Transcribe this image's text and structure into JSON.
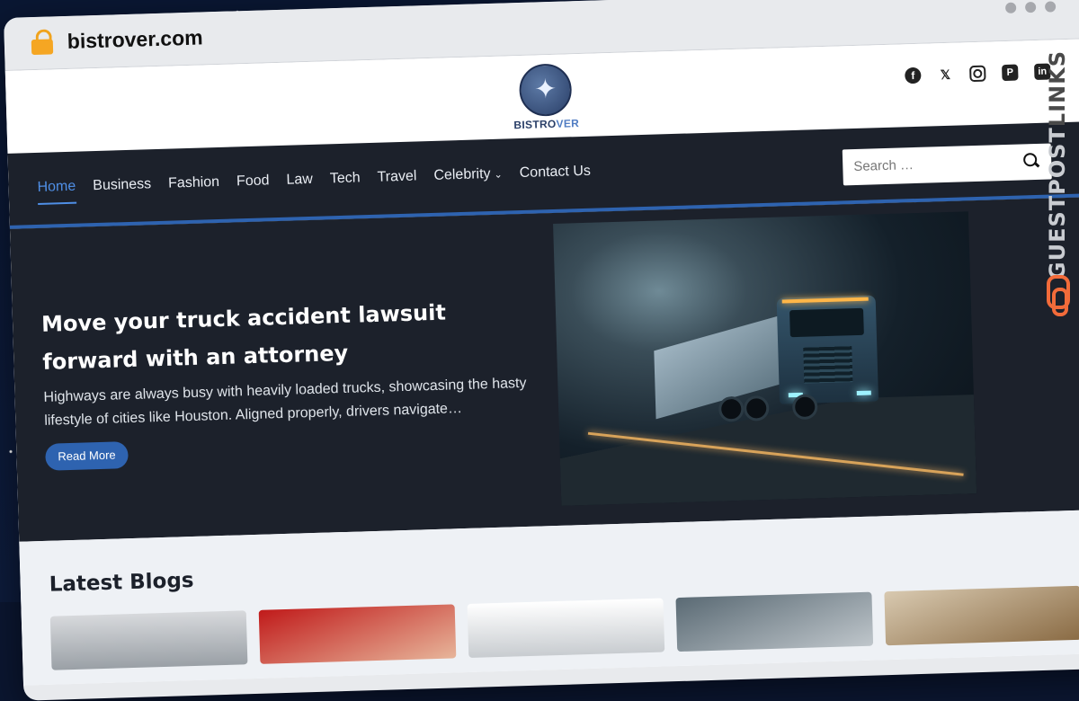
{
  "browser": {
    "url": "bistrover.com"
  },
  "site": {
    "logo_text_a": "BISTRO",
    "logo_text_b": "VER",
    "socials": [
      "facebook-icon",
      "x-icon",
      "instagram-icon",
      "pinterest-icon",
      "linkedin-icon"
    ]
  },
  "nav": {
    "items": [
      {
        "label": "Home",
        "active": true
      },
      {
        "label": "Business"
      },
      {
        "label": "Fashion"
      },
      {
        "label": "Food"
      },
      {
        "label": "Law"
      },
      {
        "label": "Tech"
      },
      {
        "label": "Travel"
      },
      {
        "label": "Celebrity",
        "dropdown": true
      },
      {
        "label": "Contact Us"
      }
    ],
    "search_placeholder": "Search …"
  },
  "hero": {
    "title": "Move your truck accident lawsuit forward with an attorney",
    "excerpt": "Highways are always busy with heavily loaded trucks, showcasing the hasty lifestyle of cities like Houston. Aligned properly, drivers navigate…",
    "button": "Read More"
  },
  "latest": {
    "heading": "Latest Blogs"
  },
  "watermark": {
    "part_light": "GUESTPOST",
    "part_dark": "LINKS"
  },
  "colors": {
    "accent": "#2e63b0",
    "nav_bg": "#1c212b",
    "watermark_icon": "#f26b3a"
  }
}
